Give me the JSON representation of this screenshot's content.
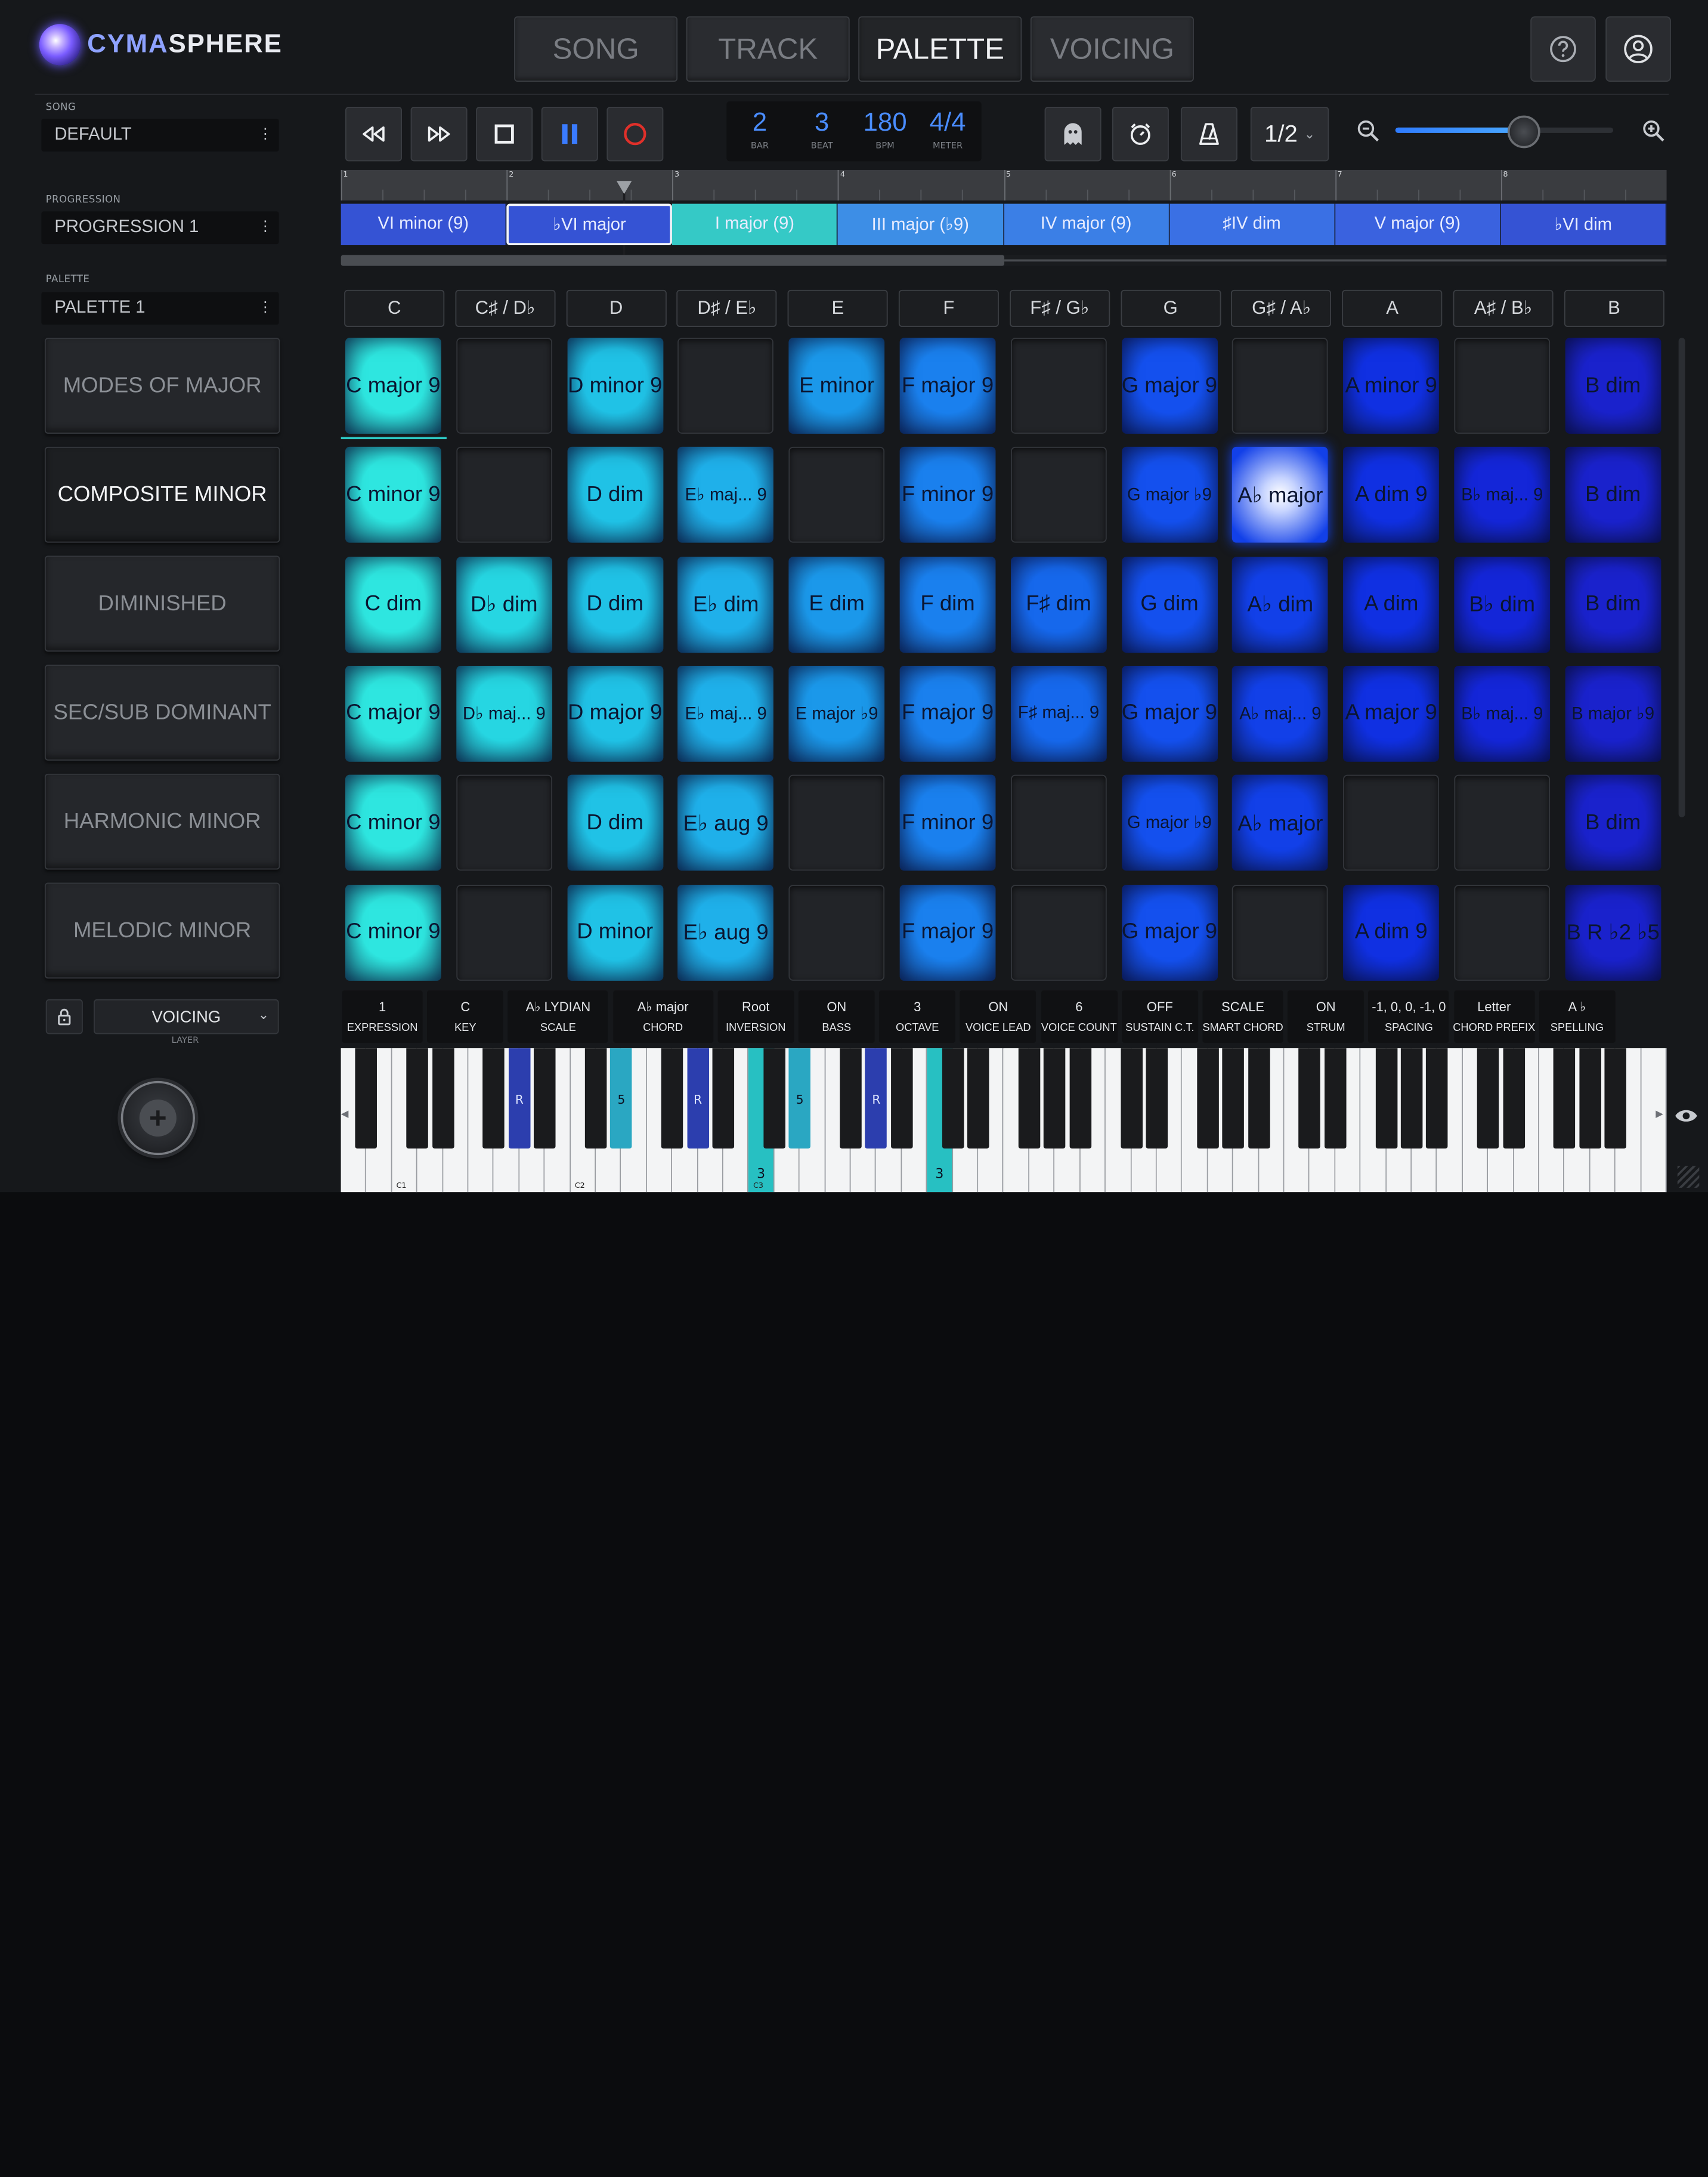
{
  "brand": {
    "name_a": "CYMA",
    "name_b": "SPHERE"
  },
  "tabs": [
    {
      "label": "SONG",
      "active": false
    },
    {
      "label": "TRACK",
      "active": false
    },
    {
      "label": "PALETTE",
      "active": true
    },
    {
      "label": "VOICING",
      "active": false
    }
  ],
  "header_icons": [
    "help-icon",
    "account-icon"
  ],
  "sidebar": {
    "song_label": "SONG",
    "song_value": "DEFAULT",
    "progression_label": "PROGRESSION",
    "progression_value": "PROGRESSION 1",
    "palette_label": "PALETTE",
    "palette_value": "PALETTE 1",
    "palettes": [
      "MODES OF MAJOR",
      "COMPOSITE MINOR",
      "DIMINISHED",
      "SEC/SUB DOMINANT",
      "HARMONIC MINOR",
      "MELODIC MINOR"
    ],
    "active_palette": "COMPOSITE MINOR",
    "layer_value": "VOICING",
    "layer_label": "LAYER"
  },
  "transport": {
    "bar": "2",
    "beat": "3",
    "bpm": "180",
    "meter": "4/4",
    "bar_label": "BAR",
    "beat_label": "BEAT",
    "bpm_label": "BPM",
    "meter_label": "METER",
    "quantize": "1/2",
    "zoom_level": 0.58,
    "colors": {
      "accent": "#4a8dff",
      "record": "#e0302a",
      "pause": "#3a7bff"
    }
  },
  "timeline": {
    "bar_numbers": [
      "1",
      "2",
      "3",
      "4",
      "5",
      "6",
      "7",
      "8"
    ],
    "playhead_bar": 2.7,
    "chords": [
      {
        "label": "VI minor (9)",
        "color": "#3553d4"
      },
      {
        "label": "♭VI major",
        "color": "#3553d4",
        "selected": true
      },
      {
        "label": "I major (9)",
        "color": "#35c9c6"
      },
      {
        "label": "III major (♭9)",
        "color": "#3d8ee6"
      },
      {
        "label": "IV major (9)",
        "color": "#3b7fe6"
      },
      {
        "label": "♯IV dim",
        "color": "#3a70e4"
      },
      {
        "label": "V major (9)",
        "color": "#3a62df"
      },
      {
        "label": "♭VI dim",
        "color": "#3553d4"
      }
    ]
  },
  "grid": {
    "columns": [
      "C",
      "C♯ / D♭",
      "D",
      "D♯ / E♭",
      "E",
      "F",
      "F♯ / G♭",
      "G",
      "G♯ / A♭",
      "A",
      "A♯ / B♭",
      "B"
    ],
    "column_colors": [
      "#2ee6e0",
      "#26d6e2",
      "#20c2e6",
      "#1fb0ea",
      "#1b98ea",
      "#1a80ee",
      "#1668ec",
      "#1450ee",
      "#1240e8",
      "#1030e2",
      "#1426d8",
      "#1a22cc"
    ],
    "rows": [
      [
        "C major 9",
        "",
        "D minor 9",
        "",
        "E minor",
        "F major 9",
        "",
        "G major 9",
        "",
        "A minor 9",
        "",
        "B dim"
      ],
      [
        "C minor 9",
        "",
        "D dim",
        "E♭ maj... 9",
        "",
        "F minor 9",
        "",
        "G major ♭9",
        "A♭ major",
        "A dim 9",
        "B♭ maj... 9",
        "B dim"
      ],
      [
        "C dim",
        "D♭ dim",
        "D dim",
        "E♭ dim",
        "E dim",
        "F dim",
        "F♯ dim",
        "G dim",
        "A♭ dim",
        "A dim",
        "B♭ dim",
        "B dim"
      ],
      [
        "C major 9",
        "D♭ maj... 9",
        "D major 9",
        "E♭ maj... 9",
        "E major ♭9",
        "F major 9",
        "F♯ maj... 9",
        "G major 9",
        "A♭ maj... 9",
        "A major 9",
        "B♭ maj... 9",
        "B major ♭9"
      ],
      [
        "C minor 9",
        "",
        "D dim",
        "E♭ aug 9",
        "",
        "F minor 9",
        "",
        "G major ♭9",
        "A♭ major",
        "",
        "",
        "B dim"
      ],
      [
        "C minor 9",
        "",
        "D minor",
        "E♭ aug 9",
        "",
        "F major 9",
        "",
        "G major 9",
        "",
        "A dim 9",
        "",
        "B R ♭2 ♭5"
      ]
    ],
    "active_cell": "A♭ major"
  },
  "params": [
    {
      "value": "1",
      "label": "EXPRESSION"
    },
    {
      "value": "C",
      "label": "KEY"
    },
    {
      "value": "A♭ LYDIAN",
      "label": "SCALE"
    },
    {
      "value": "A♭ major",
      "label": "CHORD"
    },
    {
      "value": "Root",
      "label": "INVERSION"
    },
    {
      "value": "ON",
      "label": "BASS"
    },
    {
      "value": "3",
      "label": "OCTAVE"
    },
    {
      "value": "ON",
      "label": "VOICE LEAD"
    },
    {
      "value": "6",
      "label": "VOICE COUNT"
    },
    {
      "value": "OFF",
      "label": "SUSTAIN C.T."
    },
    {
      "value": "SCALE",
      "label": "SMART CHORD"
    },
    {
      "value": "ON",
      "label": "STRUM"
    },
    {
      "value": "-1, 0, 0, -1, 0",
      "label": "SPACING"
    },
    {
      "value": "Letter",
      "label": "CHORD PREFIX"
    },
    {
      "value": "A ♭",
      "label": "SPELLING"
    }
  ],
  "keyboard": {
    "octave_labels": [
      "C1",
      "C2",
      "C3"
    ],
    "marked_keys": [
      {
        "note": "A♭1",
        "label": "R"
      },
      {
        "note": "E♭2",
        "label": "5"
      },
      {
        "note": "A♭2",
        "label": "R"
      },
      {
        "note": "C3",
        "label": "3"
      },
      {
        "note": "E♭3",
        "label": "5"
      },
      {
        "note": "A♭3",
        "label": "R"
      },
      {
        "note": "C4",
        "label": "3"
      }
    ]
  }
}
